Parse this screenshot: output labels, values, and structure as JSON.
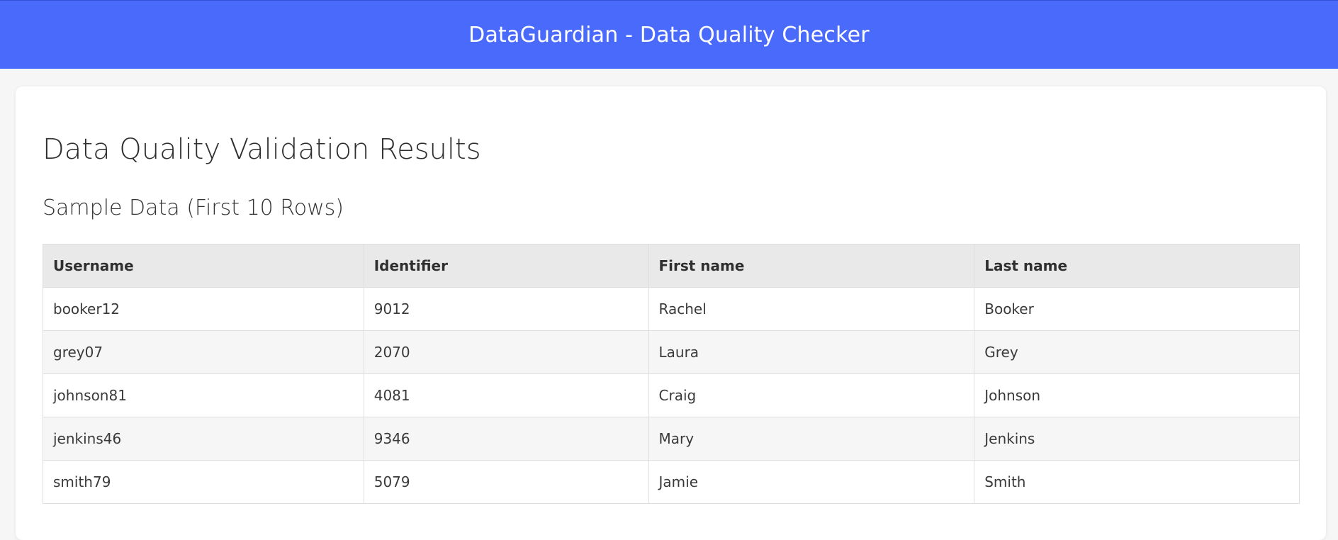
{
  "header": {
    "title": "DataGuardian - Data Quality Checker",
    "background_color": "#4a6afc"
  },
  "main": {
    "page_title": "Data Quality Validation Results",
    "section_title": "Sample Data (First 10 Rows)",
    "table": {
      "columns": [
        "Username",
        "Identifier",
        "First name",
        "Last name"
      ],
      "rows": [
        [
          "booker12",
          "9012",
          "Rachel",
          "Booker"
        ],
        [
          "grey07",
          "2070",
          "Laura",
          "Grey"
        ],
        [
          "johnson81",
          "4081",
          "Craig",
          "Johnson"
        ],
        [
          "jenkins46",
          "9346",
          "Mary",
          "Jenkins"
        ],
        [
          "smith79",
          "5079",
          "Jamie",
          "Smith"
        ]
      ]
    }
  }
}
